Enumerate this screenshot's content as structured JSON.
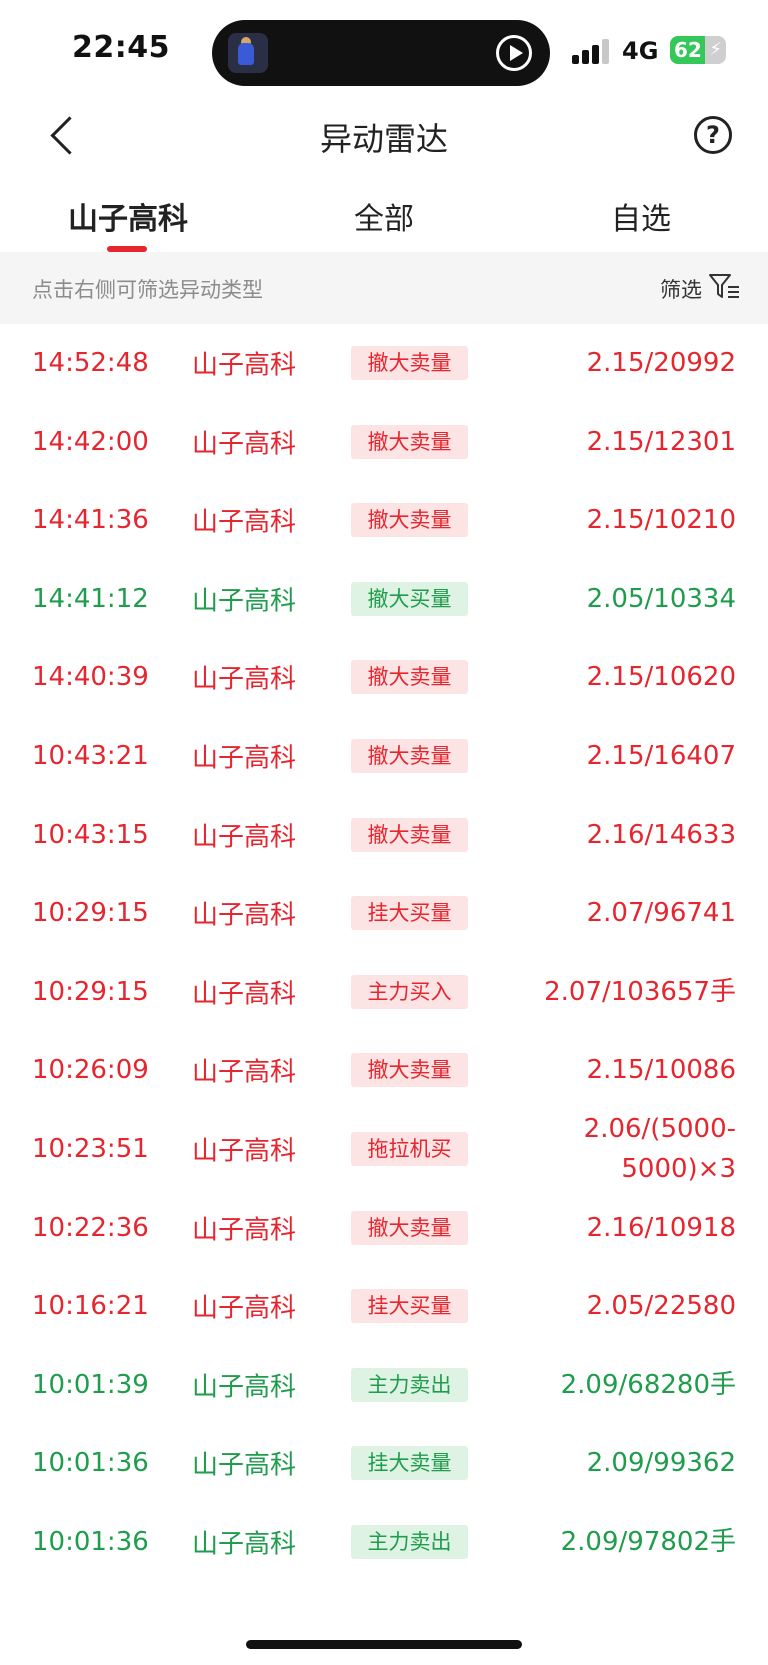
{
  "status_bar": {
    "time": "22:45",
    "network": "4G",
    "battery_percent": "62",
    "battery_level": 0.62,
    "signal_bars": 3,
    "icons": [
      "media-thumbnail-icon",
      "play-icon",
      "signal-icon",
      "battery-icon"
    ]
  },
  "nav": {
    "title": "异动雷达",
    "back_icon": "back-chevron-icon",
    "help_icon": "help-icon",
    "help_glyph": "?"
  },
  "tabs": [
    {
      "label": "山子高科",
      "active": true
    },
    {
      "label": "全部",
      "active": false
    },
    {
      "label": "自选",
      "active": false
    }
  ],
  "filter_bar": {
    "hint": "点击右侧可筛选异动类型",
    "button_label": "筛选",
    "icon": "filter-icon"
  },
  "colors": {
    "red": "#e5262f",
    "green": "#1f9d4c",
    "tag_red_bg": "#fde4e4",
    "tag_green_bg": "#def3e4"
  },
  "rows": [
    {
      "time": "14:52:48",
      "name": "山子高科",
      "type": "撤大卖量",
      "value": "2.15/20992",
      "color": "red"
    },
    {
      "time": "14:42:00",
      "name": "山子高科",
      "type": "撤大卖量",
      "value": "2.15/12301",
      "color": "red"
    },
    {
      "time": "14:41:36",
      "name": "山子高科",
      "type": "撤大卖量",
      "value": "2.15/10210",
      "color": "red"
    },
    {
      "time": "14:41:12",
      "name": "山子高科",
      "type": "撤大买量",
      "value": "2.05/10334",
      "color": "green"
    },
    {
      "time": "14:40:39",
      "name": "山子高科",
      "type": "撤大卖量",
      "value": "2.15/10620",
      "color": "red"
    },
    {
      "time": "10:43:21",
      "name": "山子高科",
      "type": "撤大卖量",
      "value": "2.15/16407",
      "color": "red"
    },
    {
      "time": "10:43:15",
      "name": "山子高科",
      "type": "撤大卖量",
      "value": "2.16/14633",
      "color": "red"
    },
    {
      "time": "10:29:15",
      "name": "山子高科",
      "type": "挂大买量",
      "value": "2.07/96741",
      "color": "red"
    },
    {
      "time": "10:29:15",
      "name": "山子高科",
      "type": "主力买入",
      "value": "2.07/103657手",
      "color": "red"
    },
    {
      "time": "10:26:09",
      "name": "山子高科",
      "type": "撤大卖量",
      "value": "2.15/10086",
      "color": "red"
    },
    {
      "time": "10:23:51",
      "name": "山子高科",
      "type": "拖拉机买",
      "value": "2.06/(5000-5000)×3",
      "color": "red"
    },
    {
      "time": "10:22:36",
      "name": "山子高科",
      "type": "撤大卖量",
      "value": "2.16/10918",
      "color": "red"
    },
    {
      "time": "10:16:21",
      "name": "山子高科",
      "type": "挂大买量",
      "value": "2.05/22580",
      "color": "red"
    },
    {
      "time": "10:01:39",
      "name": "山子高科",
      "type": "主力卖出",
      "value": "2.09/68280手",
      "color": "green"
    },
    {
      "time": "10:01:36",
      "name": "山子高科",
      "type": "挂大卖量",
      "value": "2.09/99362",
      "color": "green"
    },
    {
      "time": "10:01:36",
      "name": "山子高科",
      "type": "主力卖出",
      "value": "2.09/97802手",
      "color": "green"
    }
  ]
}
